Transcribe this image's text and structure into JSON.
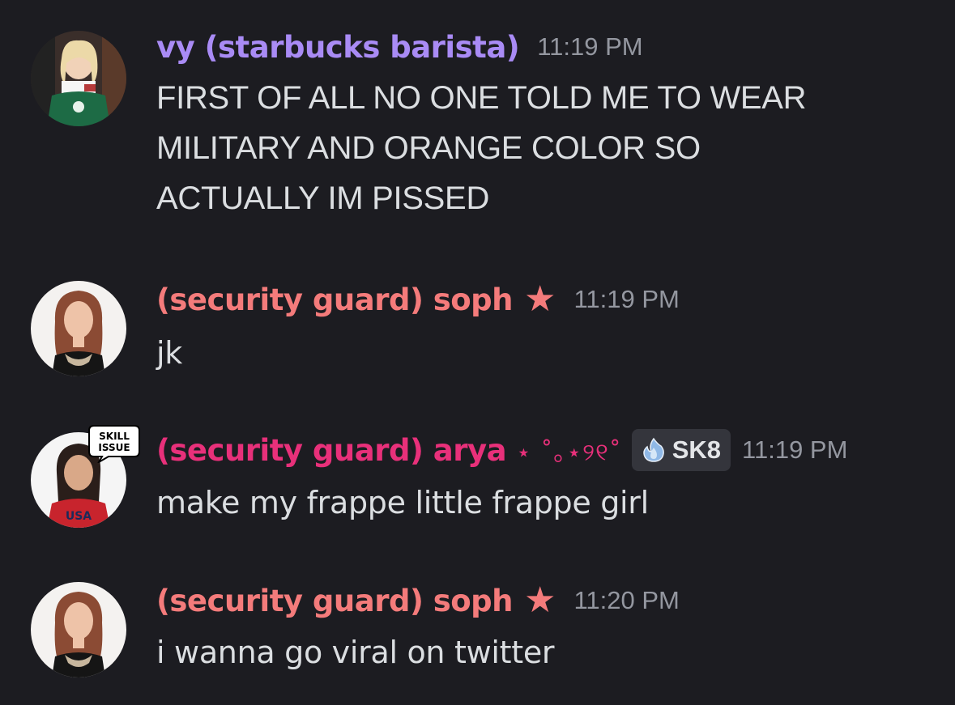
{
  "messages": [
    {
      "username": "vy (starbucks barista)",
      "username_color": "#a98bf5",
      "timestamp": "11:19 PM",
      "lines": [
        "FIRST OF ALL NO ONE TOLD ME TO WEAR",
        "MILITARY AND ORANGE COLOR SO",
        "ACTUALLY IM PISSED"
      ]
    },
    {
      "username": "(security guard) soph",
      "username_color": "#f47b7b",
      "star": "★",
      "timestamp": "11:19 PM",
      "text": "jk"
    },
    {
      "username": "(security guard) arya",
      "username_color": "#e8307a",
      "decoration": "⋆ ˚｡⋆୨୧˚",
      "tag": "SK8",
      "tag_icon": "blue-flame-icon",
      "avatar_badge": [
        "SKILL",
        "ISSUE"
      ],
      "timestamp": "11:19 PM",
      "text": "make my frappe little frappe girl"
    },
    {
      "username": "(security guard) soph",
      "username_color": "#f47b7b",
      "star": "★",
      "timestamp": "11:20 PM",
      "text": "i wanna go viral on twitter"
    }
  ]
}
